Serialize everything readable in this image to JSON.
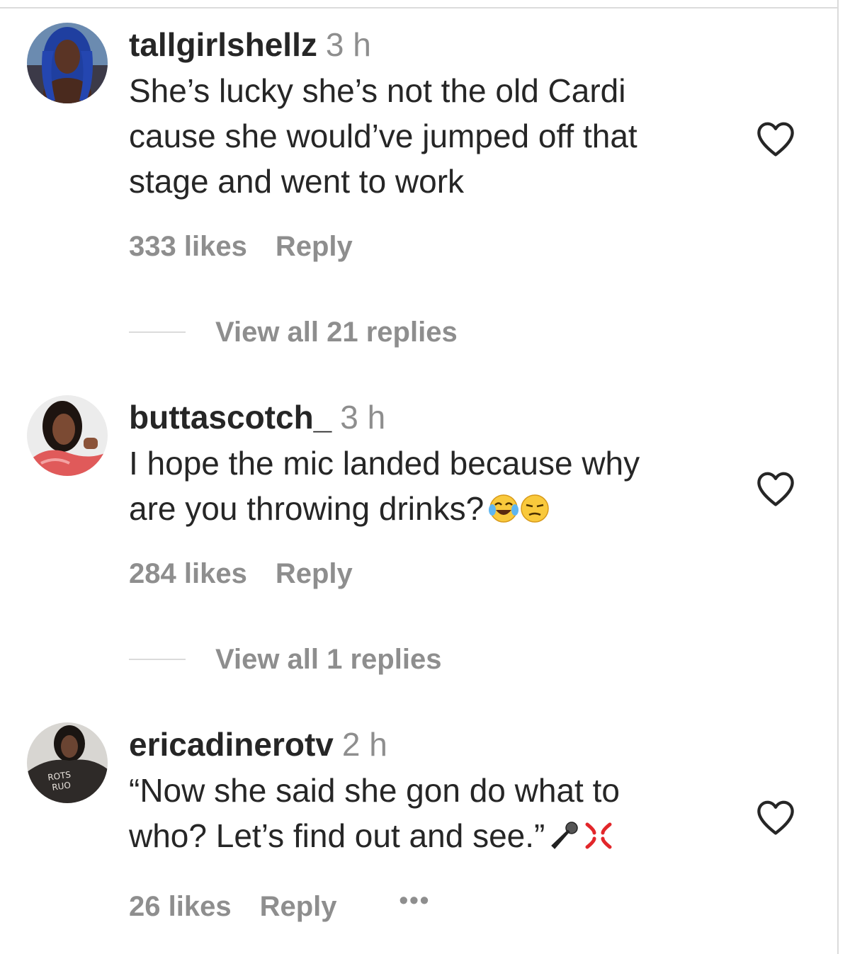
{
  "comments": [
    {
      "username": "tallgirlshellz",
      "time": "3 h",
      "text": "She’s lucky she’s not the old Cardi\ncause she would’ve jumped off that\nstage and went to work",
      "likes": "333 likes",
      "reply": "Reply",
      "view_replies": "View all 21 replies",
      "avatar": "user-avatar-blue-hair"
    },
    {
      "username": "buttascotch_",
      "time": "3 h",
      "text": "I hope the mic landed because why\nare you throwing drinks?",
      "emojis": [
        "face-with-tears-of-joy",
        "unamused-face"
      ],
      "likes": "284 likes",
      "reply": "Reply",
      "view_replies": "View all 1 replies",
      "avatar": "user-avatar-pink-top"
    },
    {
      "username": "ericadinerotv",
      "time": "2 h",
      "text": "“Now she said she gon do what to\nwho? Let’s find out and see.”",
      "emojis": [
        "microphone",
        "anger-symbol"
      ],
      "likes": "26 likes",
      "reply": "Reply",
      "more": "•••",
      "avatar": "user-avatar-dark-shirt"
    }
  ],
  "colors": {
    "primary_text": "#262626",
    "secondary_text": "#8e8e8e",
    "divider": "#dbdbdb",
    "background": "#ffffff"
  }
}
